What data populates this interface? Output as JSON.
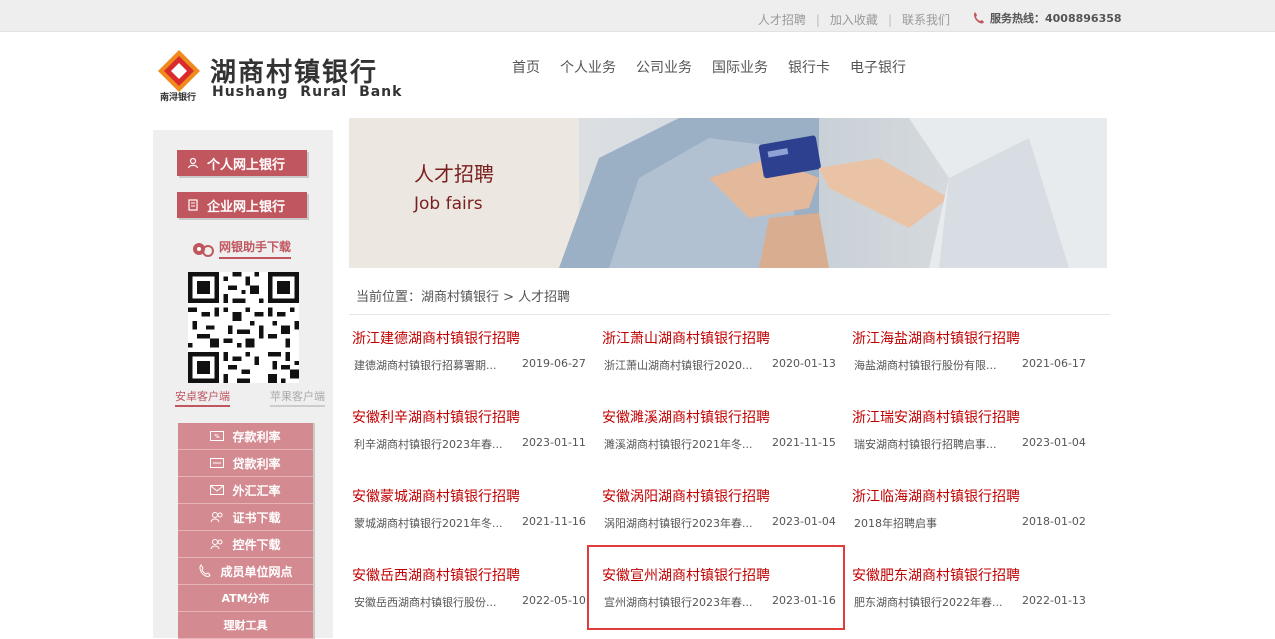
{
  "topbar": {
    "links": [
      "人才招聘",
      "加入收藏",
      "联系我们"
    ],
    "hotline_label": "服务热线：4008896358"
  },
  "logo": {
    "name_cn": "湖商村镇银行",
    "name_en": "Hushang Rural Bank",
    "sub": "南浔银行"
  },
  "nav": [
    "首页",
    "个人业务",
    "公司业务",
    "国际业务",
    "银行卡",
    "电子银行"
  ],
  "sidebar": {
    "personal_bank": "个人网上银行",
    "corporate_bank": "企业网上银行",
    "download": "网银助手下载",
    "client_android": "安卓客户端",
    "client_apple": "苹果客户端",
    "menu": [
      {
        "label": "存款利率",
        "icon": "rate-icon"
      },
      {
        "label": "贷款利率",
        "icon": "loan-icon"
      },
      {
        "label": "外汇汇率",
        "icon": "mail-icon"
      },
      {
        "label": "证书下载",
        "icon": "people-icon"
      },
      {
        "label": "控件下载",
        "icon": "people-icon"
      },
      {
        "label": "成员单位网点",
        "icon": "phone-icon"
      },
      {
        "label": "ATM分布",
        "icon": ""
      },
      {
        "label": "理财工具",
        "icon": ""
      }
    ]
  },
  "banner": {
    "title_cn": "人才招聘",
    "title_en": "Job fairs"
  },
  "breadcrumb": "当前位置：湖商村镇银行 > 人才招聘",
  "jobs": [
    {
      "title": "浙江建德湖商村镇银行招聘",
      "desc": "建德湖商村镇银行招募署期...",
      "date": "2019-06-27"
    },
    {
      "title": "浙江萧山湖商村镇银行招聘",
      "desc": "浙江萧山湖商村镇银行2020...",
      "date": "2020-01-13"
    },
    {
      "title": "浙江海盐湖商村镇银行招聘",
      "desc": "海盐湖商村镇银行股份有限...",
      "date": "2021-06-17"
    },
    {
      "title": "安徽利辛湖商村镇银行招聘",
      "desc": "利辛湖商村镇银行2023年春...",
      "date": "2023-01-11"
    },
    {
      "title": "安徽濉溪湖商村镇银行招聘",
      "desc": "濉溪湖商村镇银行2021年冬...",
      "date": "2021-11-15"
    },
    {
      "title": "浙江瑞安湖商村镇银行招聘",
      "desc": "瑞安湖商村镇银行招聘启事...",
      "date": "2023-01-04"
    },
    {
      "title": "安徽蒙城湖商村镇银行招聘",
      "desc": "蒙城湖商村镇银行2021年冬...",
      "date": "2021-11-16"
    },
    {
      "title": "安徽涡阳湖商村镇银行招聘",
      "desc": "涡阳湖商村镇银行2023年春...",
      "date": "2023-01-04"
    },
    {
      "title": "浙江临海湖商村镇银行招聘",
      "desc": "2018年招聘启事",
      "date": "2018-01-02"
    },
    {
      "title": "安徽岳西湖商村镇银行招聘",
      "desc": "安徽岳西湖商村镇银行股份...",
      "date": "2022-05-10"
    },
    {
      "title": "安徽宣州湖商村镇银行招聘",
      "desc": "宣州湖商村镇银行2023年春...",
      "date": "2023-01-16"
    },
    {
      "title": "安徽肥东湖商村镇银行招聘",
      "desc": "肥东湖商村镇银行2022年春...",
      "date": "2022-01-13"
    }
  ],
  "colors": {
    "accent": "#c0575f",
    "title_red": "#c00000",
    "highlight": "#e03c3c"
  }
}
